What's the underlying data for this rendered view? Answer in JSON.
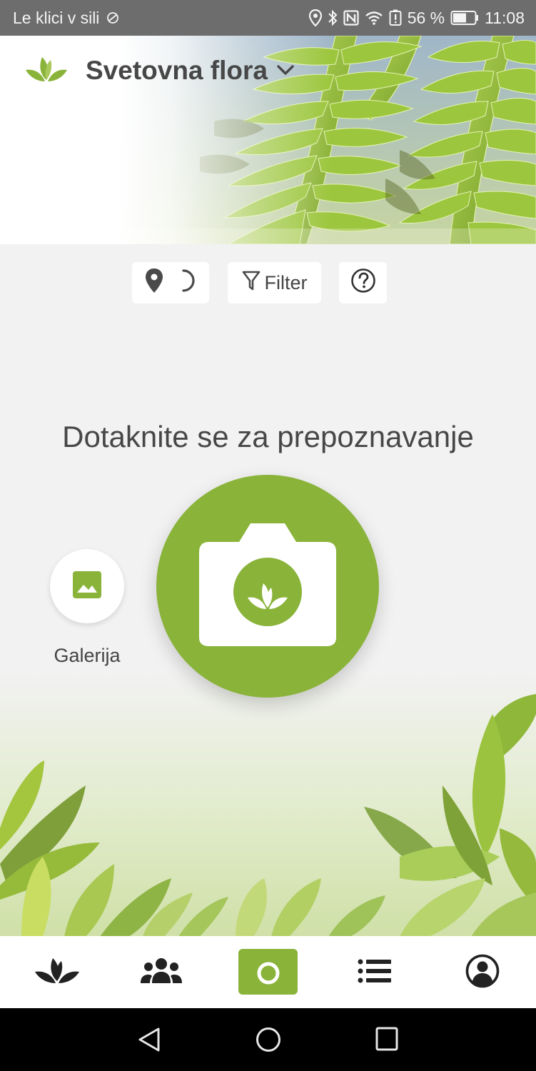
{
  "status_bar": {
    "carrier": "Le klici v sili",
    "battery_percent": "56 %",
    "time": "11:08"
  },
  "header": {
    "title": "Svetovna flora"
  },
  "toolbar": {
    "filter_label": "Filter"
  },
  "main": {
    "prompt": "Dotaknite se za prepoznavanje",
    "gallery_label": "Galerija"
  },
  "colors": {
    "accent": "#8ab33a",
    "text": "#474747"
  },
  "bottom_nav": {
    "items": [
      "plants",
      "community",
      "camera",
      "list",
      "profile"
    ],
    "active": "camera"
  }
}
